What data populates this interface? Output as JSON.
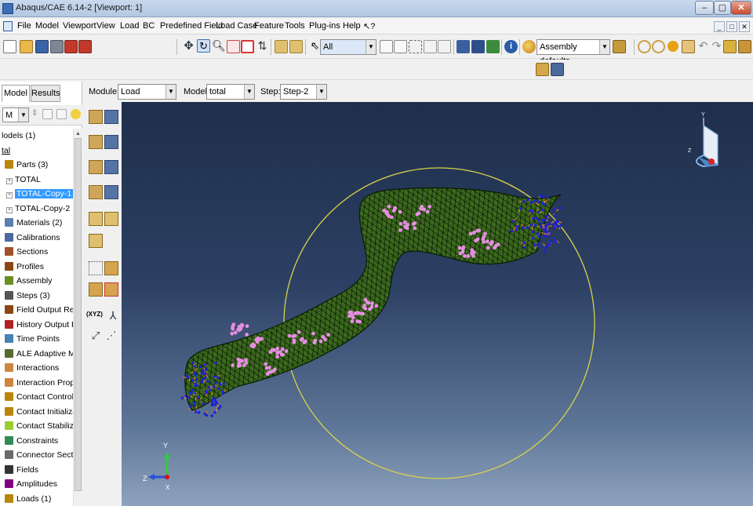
{
  "window": {
    "title": "Abaqus/CAE 6.14-2 [Viewport: 1]",
    "minimize": "–",
    "maximize": "▢",
    "close": "✕"
  },
  "menubar": {
    "items": [
      "File",
      "Model",
      "Viewport",
      "View",
      "Load",
      "BC",
      "Predefined Field",
      "Load Case",
      "Feature",
      "Tools",
      "Plug-ins",
      "Help",
      "↖?"
    ],
    "mdi": [
      "_",
      "□",
      "✕"
    ]
  },
  "toolbar": {
    "selection_filter": "All",
    "render_style": "Assembly defaults"
  },
  "context": {
    "module_label": "Module:",
    "module_value": "Load",
    "model_label": "Model:",
    "model_value": "total",
    "step_label": "Step:",
    "step_value": "Step-2"
  },
  "left_panel": {
    "tabs": [
      "Model",
      "Results"
    ],
    "tree_combo": "M",
    "tree": [
      {
        "label": "lodels (1)",
        "indent": 0,
        "icon": "none"
      },
      {
        "label": "tal",
        "indent": 0,
        "icon": "none",
        "underline": true
      },
      {
        "label": "Parts (3)",
        "indent": 1,
        "icon": "parts-icon",
        "color": "#b8860b"
      },
      {
        "label": "TOTAL",
        "indent": 2,
        "icon": "expander"
      },
      {
        "label": "TOTAL-Copy-1",
        "indent": 2,
        "icon": "expander",
        "selected": true
      },
      {
        "label": "TOTAL-Copy-2",
        "indent": 2,
        "icon": "expander"
      },
      {
        "label": "Materials (2)",
        "indent": 1,
        "icon": "materials-icon",
        "color": "#5a7fb0"
      },
      {
        "label": "Calibrations",
        "indent": 1,
        "icon": "calibrations-icon",
        "color": "#4a6aa0"
      },
      {
        "label": "Sections",
        "indent": 1,
        "icon": "sections-icon",
        "color": "#a0522d"
      },
      {
        "label": "Profiles",
        "indent": 1,
        "icon": "profiles-icon",
        "color": "#8b4513"
      },
      {
        "label": "Assembly",
        "indent": 1,
        "icon": "assembly-icon",
        "color": "#6b8e23"
      },
      {
        "label": "Steps (3)",
        "indent": 1,
        "icon": "steps-icon",
        "color": "#555555"
      },
      {
        "label": "Field Output Reque",
        "indent": 1,
        "icon": "field-output-icon",
        "color": "#8b4513"
      },
      {
        "label": "History Output Rec",
        "indent": 1,
        "icon": "history-output-icon",
        "color": "#b22222"
      },
      {
        "label": "Time Points",
        "indent": 1,
        "icon": "time-points-icon",
        "color": "#4682b4"
      },
      {
        "label": "ALE Adaptive Mesh",
        "indent": 1,
        "icon": "ale-mesh-icon",
        "color": "#556b2f"
      },
      {
        "label": "Interactions",
        "indent": 1,
        "icon": "interactions-icon",
        "color": "#cd853f"
      },
      {
        "label": "Interaction Propert",
        "indent": 1,
        "icon": "interaction-props-icon",
        "color": "#cd853f"
      },
      {
        "label": "Contact Controls",
        "indent": 1,
        "icon": "contact-controls-icon",
        "color": "#b8860b"
      },
      {
        "label": "Contact Initializatio",
        "indent": 1,
        "icon": "contact-init-icon",
        "color": "#b8860b"
      },
      {
        "label": "Contact Stabilizatio",
        "indent": 1,
        "icon": "contact-stab-icon",
        "color": "#9acd32"
      },
      {
        "label": "Constraints",
        "indent": 1,
        "icon": "constraints-icon",
        "color": "#2e8b57"
      },
      {
        "label": "Connector Section:",
        "indent": 1,
        "icon": "connector-icon",
        "color": "#696969"
      },
      {
        "label": "Fields",
        "indent": 1,
        "icon": "fields-icon",
        "color": "#333333"
      },
      {
        "label": "Amplitudes",
        "indent": 1,
        "icon": "amplitudes-icon",
        "color": "#800080"
      },
      {
        "label": "Loads (1)",
        "indent": 1,
        "icon": "loads-icon",
        "color": "#b8860b"
      }
    ]
  },
  "viewport": {
    "triad": {
      "y": "Y",
      "z": "Z",
      "x": "X"
    },
    "view_cube": {
      "y": "Y",
      "z": "Z"
    },
    "toolbox_labels": {
      "xyz": "(XYZ)"
    },
    "colors": {
      "mesh_fill": "#3d6b1e",
      "mesh_line": "#0a1a05",
      "load_marker": "#e58ee0",
      "bc_marker_blue": "#1a23d8",
      "bc_marker_orange": "#f08030",
      "circle": "#d8d24a"
    }
  }
}
